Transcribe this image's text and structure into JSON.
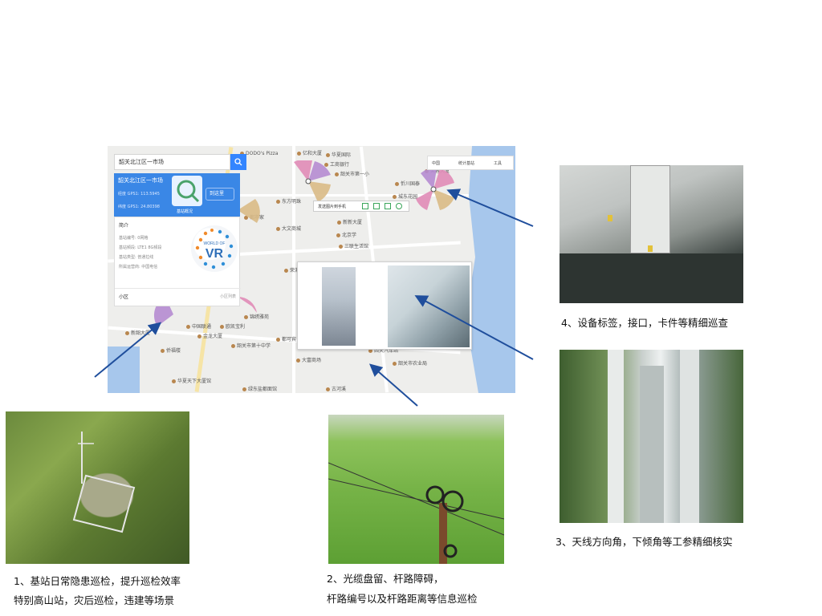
{
  "map": {
    "search_text": "韶关北江区一市场",
    "info": {
      "title": "韶关北江区一市场",
      "lng": "经度 GPS1: 113.5945",
      "lat": "纬度 GPS1: 24.80398",
      "link": "基站概况",
      "route": "到这里"
    },
    "detail": {
      "intro": "简介",
      "rows": [
        "基站编号: 0网格",
        "基站频段: LTE1 8G频段",
        "基站类型: 普通拉线",
        "所属运营商: 中国电信"
      ],
      "cell": "小区",
      "cell_link": "小区列表"
    },
    "logo_text": "WORLD OF VR",
    "toolbar": {
      "region": "中国",
      "stats": "统计基站",
      "tools": "工具"
    },
    "popup_bar": "发送图片到手机",
    "pois": [
      {
        "t": "DODO's Pizza"
      },
      {
        "t": "亿和大厦"
      },
      {
        "t": "工商银行"
      },
      {
        "t": "韶关市第一小"
      },
      {
        "t": "东方明珠"
      },
      {
        "t": "都市家"
      },
      {
        "t": "大文商城"
      },
      {
        "t": "北京学"
      },
      {
        "t": "中国联通"
      },
      {
        "t": "欧凯宝利"
      },
      {
        "t": "金龙大厦"
      },
      {
        "t": "锦绣雅苑"
      },
      {
        "t": "侨福楼"
      },
      {
        "t": "华夏天下大厦馆"
      },
      {
        "t": "新韶大厦"
      },
      {
        "t": "大富商场"
      },
      {
        "t": "都可宾"
      },
      {
        "t": "韶关市第十中学"
      },
      {
        "t": "城东花园"
      },
      {
        "t": "芙蓉大厦"
      },
      {
        "t": "西关汽车站"
      },
      {
        "t": "韶关市农业局"
      },
      {
        "t": "古河溪"
      },
      {
        "t": "绿东盐都面馆"
      },
      {
        "t": "荣港"
      },
      {
        "t": "忻川国泰"
      },
      {
        "t": "华夏国际"
      },
      {
        "t": "三联生活馆"
      },
      {
        "t": "新新大厦"
      }
    ]
  },
  "captions": {
    "c1_line1": "1、基站日常隐患巡检，提升巡检效率",
    "c1_line2": "特别高山站，灾后巡检，违建等场景",
    "c2_line1": "2、光缆盘留、杆路障碍，",
    "c2_line2": "杆路编号以及杆路距离等信息巡检",
    "c3": "3、天线方向角，下倾角等工参精细核实",
    "c4": "4、设备标签，接口，卡件等精细巡查"
  },
  "colors": {
    "arrow": "#1f4e9c",
    "accent": "#3385ff",
    "sector_pink": "#e08bb7",
    "sector_purple": "#b58bd2",
    "sector_tan": "#d9ba86"
  }
}
